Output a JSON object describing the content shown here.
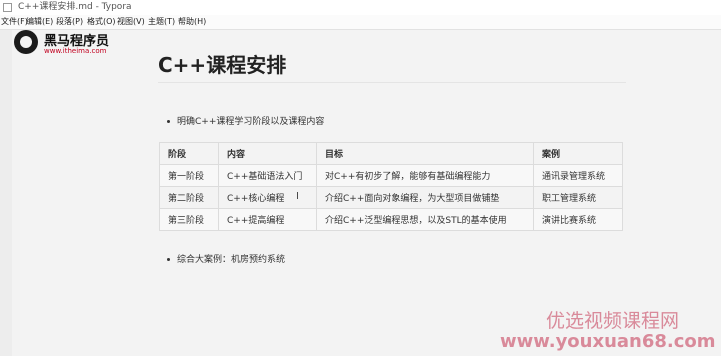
{
  "window": {
    "title": "C++课程安排.md - Typora"
  },
  "menu": [
    "文件(F)",
    "编辑(E)",
    "段落(P)",
    "格式(O)",
    "视图(V)",
    "主题(T)",
    "帮助(H)"
  ],
  "logo": {
    "name": "黑马程序员",
    "url": "www.itheima.com"
  },
  "document": {
    "title": "C++课程安排",
    "bullet1": "明确C++课程学习阶段以及课程内容",
    "table": {
      "headers": [
        "阶段",
        "内容",
        "目标",
        "案例"
      ],
      "rows": [
        [
          "第一阶段",
          "C++基础语法入门",
          "对C++有初步了解，能够有基础编程能力",
          "通讯录管理系统"
        ],
        [
          "第二阶段",
          "C++核心编程",
          "介绍C++面向对象编程，为大型项目做铺垫",
          "职工管理系统"
        ],
        [
          "第三阶段",
          "C++提高编程",
          "介绍C++泛型编程思想，以及STL的基本使用",
          "演讲比赛系统"
        ]
      ]
    },
    "bullet2": "综合大案例：机房预约系统"
  },
  "watermark": {
    "line1": "优选视频课程网",
    "line2": "www.youxuan68.com"
  }
}
